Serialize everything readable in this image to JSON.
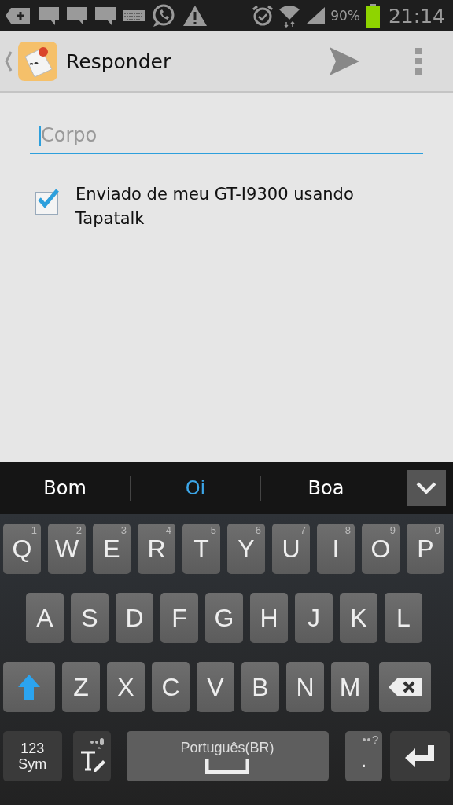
{
  "status_bar": {
    "battery_text": "90%",
    "time": "21:14"
  },
  "action_bar": {
    "title": "Responder"
  },
  "body_field": {
    "placeholder": "Corpo"
  },
  "signature": {
    "label": "Enviado de meu GT-I9300 usando Tapatalk",
    "checked": true
  },
  "suggestions": [
    {
      "text": "Bom",
      "selected": false
    },
    {
      "text": "Oi",
      "selected": true
    },
    {
      "text": "Boa",
      "selected": false
    }
  ],
  "keyboard": {
    "rows": [
      {
        "keys": [
          {
            "kind": "letter",
            "label": "Q",
            "hint": "1"
          },
          {
            "kind": "letter",
            "label": "W",
            "hint": "2"
          },
          {
            "kind": "letter",
            "label": "E",
            "hint": "3"
          },
          {
            "kind": "letter",
            "label": "R",
            "hint": "4"
          },
          {
            "kind": "letter",
            "label": "T",
            "hint": "5"
          },
          {
            "kind": "letter",
            "label": "Y",
            "hint": "6"
          },
          {
            "kind": "letter",
            "label": "U",
            "hint": "7"
          },
          {
            "kind": "letter",
            "label": "I",
            "hint": "8"
          },
          {
            "kind": "letter",
            "label": "O",
            "hint": "9"
          },
          {
            "kind": "letter",
            "label": "P",
            "hint": "0"
          }
        ]
      },
      {
        "keys": [
          {
            "kind": "letter",
            "label": "A"
          },
          {
            "kind": "letter",
            "label": "S"
          },
          {
            "kind": "letter",
            "label": "D"
          },
          {
            "kind": "letter",
            "label": "F"
          },
          {
            "kind": "letter",
            "label": "G"
          },
          {
            "kind": "letter",
            "label": "H"
          },
          {
            "kind": "letter",
            "label": "J"
          },
          {
            "kind": "letter",
            "label": "K"
          },
          {
            "kind": "letter",
            "label": "L"
          }
        ]
      },
      {
        "keys": [
          {
            "kind": "shift"
          },
          {
            "kind": "letter",
            "label": "Z"
          },
          {
            "kind": "letter",
            "label": "X"
          },
          {
            "kind": "letter",
            "label": "C"
          },
          {
            "kind": "letter",
            "label": "V"
          },
          {
            "kind": "letter",
            "label": "B"
          },
          {
            "kind": "letter",
            "label": "N"
          },
          {
            "kind": "letter",
            "label": "M"
          },
          {
            "kind": "backspace"
          }
        ]
      },
      {
        "keys": [
          {
            "kind": "symbols",
            "lines": [
              "123",
              "Sym"
            ]
          },
          {
            "kind": "handwriting"
          },
          {
            "kind": "space",
            "label": "Português(BR)"
          },
          {
            "kind": "period",
            "label": ".",
            "hint": "?"
          },
          {
            "kind": "enter"
          }
        ]
      }
    ]
  }
}
